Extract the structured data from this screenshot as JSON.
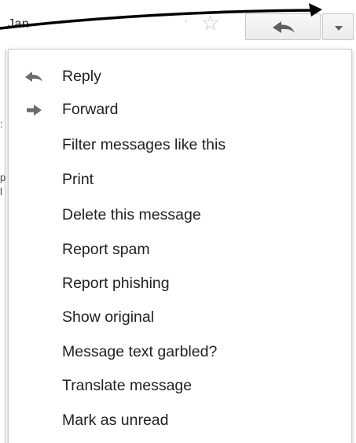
{
  "header": {
    "sender": "Jan",
    "sender_tail": "’",
    "star_glyph": "☆"
  },
  "icons": {
    "reply": "reply-arrow-icon",
    "forward": "forward-arrow-icon",
    "more": "caret-down-icon",
    "star": "star-icon"
  },
  "menu": {
    "items": [
      {
        "label": "Reply"
      },
      {
        "label": "Forward"
      },
      {
        "label": "Filter messages like this"
      },
      {
        "label": "Print"
      },
      {
        "label": "Delete this message"
      },
      {
        "label": "Report spam"
      },
      {
        "label": "Report phishing"
      },
      {
        "label": "Show original"
      },
      {
        "label": "Message text garbled?"
      },
      {
        "label": "Translate message"
      },
      {
        "label": "Mark as unread"
      }
    ]
  },
  "colors": {
    "text": "#222222",
    "icon": "#6b6b6b",
    "border": "#cfcfcf",
    "arrow": "#000000"
  }
}
